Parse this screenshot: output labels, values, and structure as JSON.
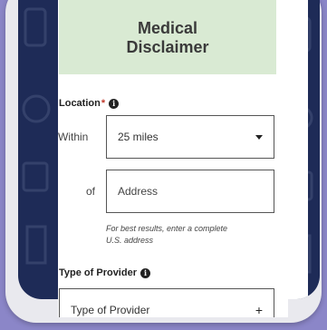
{
  "disclaimer": {
    "line1": "Medical",
    "line2": "Disclaimer"
  },
  "location": {
    "label": "Location",
    "required_mark": "*",
    "info_icon": "info-icon",
    "within_label": "Within",
    "within_value": "25 miles",
    "of_label": "of",
    "address_placeholder": "Address",
    "hint_line1": "For best results, enter a complete",
    "hint_line2": "U.S. address"
  },
  "provider": {
    "label": "Type of Provider",
    "info_icon": "info-icon",
    "placeholder": "Type of Provider",
    "expand_icon": "plus-icon"
  },
  "colors": {
    "background": "#8b86c8",
    "frame": "#1e2b57",
    "disclaimer_bg": "#d9ead3",
    "required": "#c0392b"
  }
}
